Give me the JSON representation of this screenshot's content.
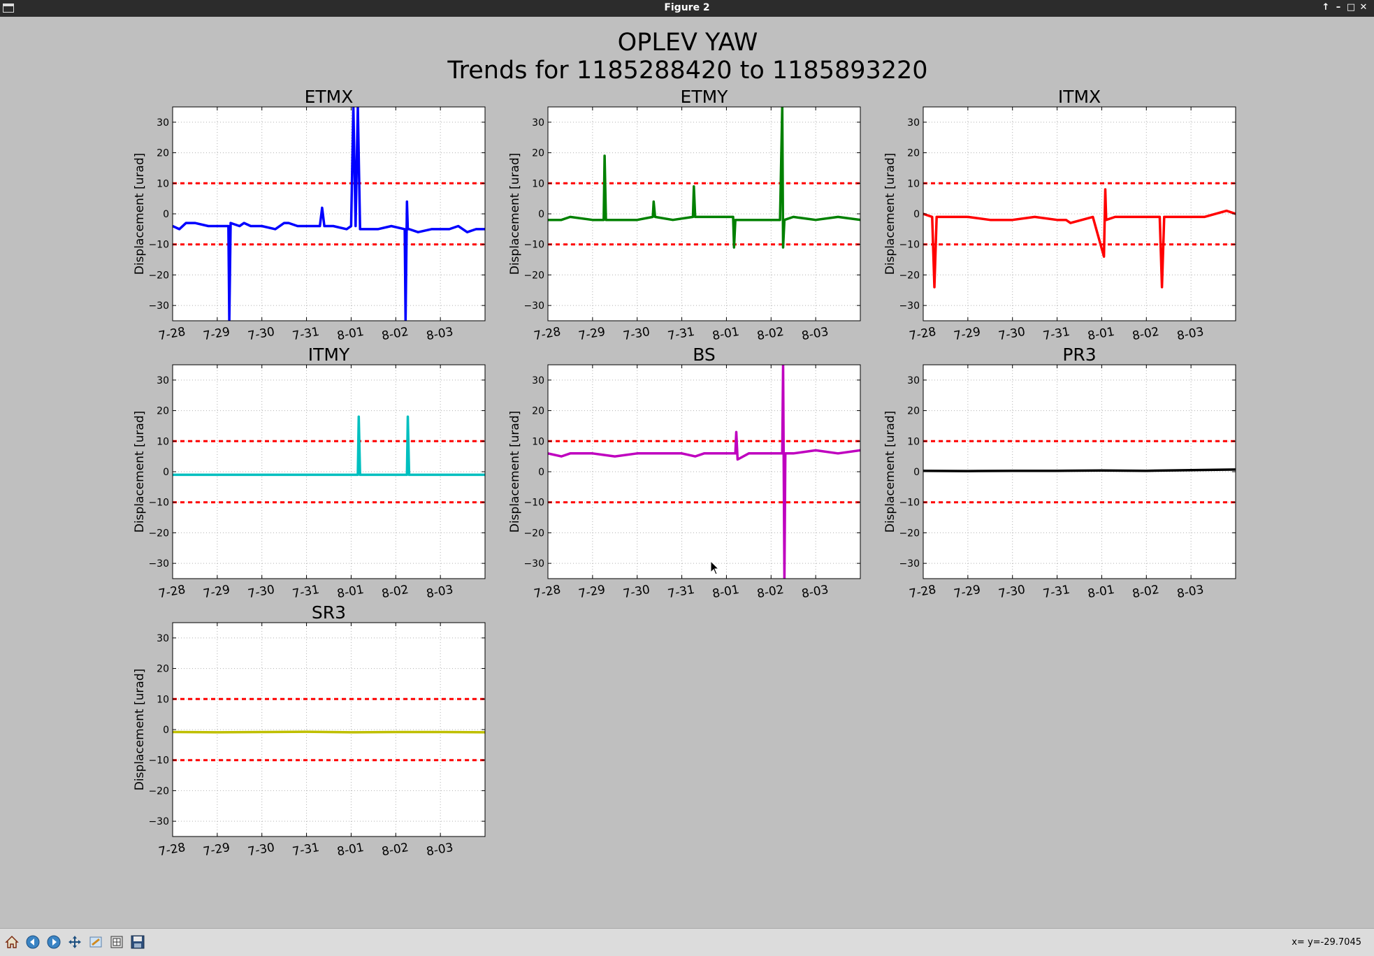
{
  "window": {
    "title": "Figure 2"
  },
  "window_controls": [
    "↑",
    "–",
    "□",
    "✕"
  ],
  "figure": {
    "title_line1": "OPLEV YAW",
    "title_line2": "Trends for 1185288420 to 1185893220"
  },
  "status_text": "x= y=-29.7045",
  "toolbar_icons": [
    "home-icon",
    "back-icon",
    "forward-icon",
    "pan-icon",
    "zoom-icon",
    "configure-subplots-icon",
    "save-icon"
  ],
  "chart_data": [
    {
      "type": "line",
      "title": "ETMX",
      "ylabel": "Displacement [urad]",
      "color": "#0000ff",
      "xlim": [
        0,
        7
      ],
      "ylim": [
        -35,
        35
      ],
      "yticks": [
        -30,
        -20,
        -10,
        0,
        10,
        20,
        30
      ],
      "xticks": [
        0,
        1,
        2,
        3,
        4,
        5,
        6
      ],
      "xticklabels": [
        "7-28",
        "7-29",
        "7-30",
        "7-31",
        "8-01",
        "8-02",
        "8-03"
      ],
      "thresholds": [
        10,
        -10
      ],
      "threshold_color": "#ff0000",
      "grid": true,
      "series": [
        {
          "x": [
            0,
            0.15,
            0.3,
            0.5,
            0.8,
            1.0,
            1.25,
            1.27,
            1.3,
            1.5,
            1.6,
            1.75,
            2.0,
            2.3,
            2.5,
            2.6,
            2.8,
            3.0,
            3.2,
            3.3,
            3.35,
            3.4,
            3.6,
            3.9,
            4.0,
            4.05,
            4.1,
            4.15,
            4.2,
            4.3,
            4.6,
            4.9,
            5.2,
            5.22,
            5.25,
            5.27,
            5.3,
            5.5,
            5.8,
            6.2,
            6.4,
            6.6,
            6.8,
            7.0
          ],
          "y": [
            -4,
            -5,
            -3,
            -3,
            -4,
            -4,
            -4,
            -35,
            -3,
            -4,
            -3,
            -4,
            -4,
            -5,
            -3,
            -3,
            -4,
            -4,
            -4,
            -4,
            2,
            -4,
            -4,
            -5,
            -4,
            35,
            -4,
            35,
            -5,
            -5,
            -5,
            -4,
            -5,
            -35,
            4,
            -5,
            -5,
            -6,
            -5,
            -5,
            -4,
            -6,
            -5,
            -5
          ]
        }
      ]
    },
    {
      "type": "line",
      "title": "ETMY",
      "ylabel": "Displacement [urad]",
      "color": "#008000",
      "xlim": [
        0,
        7
      ],
      "ylim": [
        -35,
        35
      ],
      "yticks": [
        -30,
        -20,
        -10,
        0,
        10,
        20,
        30
      ],
      "xticks": [
        0,
        1,
        2,
        3,
        4,
        5,
        6
      ],
      "xticklabels": [
        "7-28",
        "7-29",
        "7-30",
        "7-31",
        "8-01",
        "8-02",
        "8-03"
      ],
      "thresholds": [
        10,
        -10
      ],
      "threshold_color": "#ff0000",
      "grid": true,
      "series": [
        {
          "x": [
            0,
            0.3,
            0.5,
            1.0,
            1.25,
            1.27,
            1.3,
            1.6,
            2.0,
            2.35,
            2.37,
            2.4,
            2.8,
            3.25,
            3.27,
            3.3,
            3.8,
            4.15,
            4.17,
            4.2,
            4.5,
            5.0,
            5.2,
            5.25,
            5.27,
            5.3,
            5.5,
            6.0,
            6.5,
            7.0
          ],
          "y": [
            -2,
            -2,
            -1,
            -2,
            -2,
            19,
            -2,
            -2,
            -2,
            -1,
            4,
            -1,
            -2,
            -1,
            9,
            -1,
            -1,
            -1,
            -11,
            -2,
            -2,
            -2,
            -2,
            35,
            -11,
            -2,
            -1,
            -2,
            -1,
            -2
          ]
        }
      ]
    },
    {
      "type": "line",
      "title": "ITMX",
      "ylabel": "Displacement [urad]",
      "color": "#ff0000",
      "xlim": [
        0,
        7
      ],
      "ylim": [
        -35,
        35
      ],
      "yticks": [
        -30,
        -20,
        -10,
        0,
        10,
        20,
        30
      ],
      "xticks": [
        0,
        1,
        2,
        3,
        4,
        5,
        6
      ],
      "xticklabels": [
        "7-28",
        "7-29",
        "7-30",
        "7-31",
        "8-01",
        "8-02",
        "8-03"
      ],
      "thresholds": [
        10,
        -10
      ],
      "threshold_color": "#ff0000",
      "grid": true,
      "series": [
        {
          "x": [
            0,
            0.2,
            0.25,
            0.3,
            0.6,
            1.0,
            1.5,
            2.0,
            2.5,
            3.0,
            3.2,
            3.3,
            3.8,
            4.05,
            4.08,
            4.1,
            4.3,
            4.8,
            5.3,
            5.35,
            5.4,
            5.8,
            6.3,
            6.8,
            7.0
          ],
          "y": [
            0,
            -1,
            -24,
            -1,
            -1,
            -1,
            -2,
            -2,
            -1,
            -2,
            -2,
            -3,
            -1,
            -14,
            8,
            -2,
            -1,
            -1,
            -1,
            -24,
            -1,
            -1,
            -1,
            1,
            0
          ]
        }
      ]
    },
    {
      "type": "line",
      "title": "ITMY",
      "ylabel": "Displacement [urad]",
      "color": "#00bfbf",
      "xlim": [
        0,
        7
      ],
      "ylim": [
        -35,
        35
      ],
      "yticks": [
        -30,
        -20,
        -10,
        0,
        10,
        20,
        30
      ],
      "xticks": [
        0,
        1,
        2,
        3,
        4,
        5,
        6
      ],
      "xticklabels": [
        "7-28",
        "7-29",
        "7-30",
        "7-31",
        "8-01",
        "8-02",
        "8-03"
      ],
      "thresholds": [
        10,
        -10
      ],
      "threshold_color": "#ff0000",
      "grid": true,
      "series": [
        {
          "x": [
            0,
            1.0,
            2.0,
            3.0,
            4.15,
            4.17,
            4.2,
            5.0,
            5.25,
            5.27,
            5.3,
            6.0,
            7.0
          ],
          "y": [
            -1,
            -1,
            -1,
            -1,
            -1,
            18,
            -1,
            -1,
            -1,
            18,
            -1,
            -1,
            -1
          ]
        }
      ]
    },
    {
      "type": "line",
      "title": "BS",
      "ylabel": "Displacement [urad]",
      "color": "#bf00bf",
      "xlim": [
        0,
        7
      ],
      "ylim": [
        -35,
        35
      ],
      "yticks": [
        -30,
        -20,
        -10,
        0,
        10,
        20,
        30
      ],
      "xticks": [
        0,
        1,
        2,
        3,
        4,
        5,
        6
      ],
      "xticklabels": [
        "7-28",
        "7-29",
        "7-30",
        "7-31",
        "8-01",
        "8-02",
        "8-03"
      ],
      "thresholds": [
        10,
        -10
      ],
      "threshold_color": "#ff0000",
      "grid": true,
      "series": [
        {
          "x": [
            0,
            0.3,
            0.5,
            1.0,
            1.5,
            2.0,
            2.5,
            3.0,
            3.3,
            3.5,
            4.0,
            4.2,
            4.22,
            4.25,
            4.5,
            5.0,
            5.25,
            5.27,
            5.3,
            5.32,
            5.5,
            6.0,
            6.5,
            7.0
          ],
          "y": [
            6,
            5,
            6,
            6,
            5,
            6,
            6,
            6,
            5,
            6,
            6,
            6,
            13,
            4,
            6,
            6,
            6,
            35,
            -35,
            6,
            6,
            7,
            6,
            7
          ]
        }
      ]
    },
    {
      "type": "line",
      "title": "PR3",
      "ylabel": "Displacement [urad]",
      "color": "#000000",
      "xlim": [
        0,
        7
      ],
      "ylim": [
        -35,
        35
      ],
      "yticks": [
        -30,
        -20,
        -10,
        0,
        10,
        20,
        30
      ],
      "xticks": [
        0,
        1,
        2,
        3,
        4,
        5,
        6
      ],
      "xticklabels": [
        "7-28",
        "7-29",
        "7-30",
        "7-31",
        "8-01",
        "8-02",
        "8-03"
      ],
      "thresholds": [
        10,
        -10
      ],
      "threshold_color": "#ff0000",
      "grid": true,
      "series": [
        {
          "x": [
            0,
            1,
            2,
            3,
            4,
            5,
            6,
            7
          ],
          "y": [
            0.3,
            0.2,
            0.3,
            0.3,
            0.4,
            0.3,
            0.5,
            0.7
          ]
        }
      ]
    },
    {
      "type": "line",
      "title": "SR3",
      "ylabel": "Displacement [urad]",
      "color": "#bfbf00",
      "xlim": [
        0,
        7
      ],
      "ylim": [
        -35,
        35
      ],
      "yticks": [
        -30,
        -20,
        -10,
        0,
        10,
        20,
        30
      ],
      "xticks": [
        0,
        1,
        2,
        3,
        4,
        5,
        6
      ],
      "xticklabels": [
        "7-28",
        "7-29",
        "7-30",
        "7-31",
        "8-01",
        "8-02",
        "8-03"
      ],
      "thresholds": [
        10,
        -10
      ],
      "threshold_color": "#ff0000",
      "grid": true,
      "series": [
        {
          "x": [
            0,
            1,
            2,
            3,
            4,
            5,
            6,
            7
          ],
          "y": [
            -0.8,
            -0.9,
            -0.8,
            -0.7,
            -0.9,
            -0.8,
            -0.8,
            -0.9
          ]
        }
      ]
    }
  ]
}
